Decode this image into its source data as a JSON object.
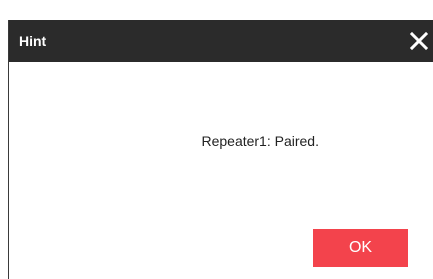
{
  "dialog": {
    "title": "Hint",
    "message": "Repeater1: Paired.",
    "ok_label": "OK",
    "close_icon": "close-icon"
  },
  "colors": {
    "header_background": "#2b2b2b",
    "header_text": "#ffffff",
    "ok_button": "#f3434c",
    "message_text": "#222222"
  }
}
